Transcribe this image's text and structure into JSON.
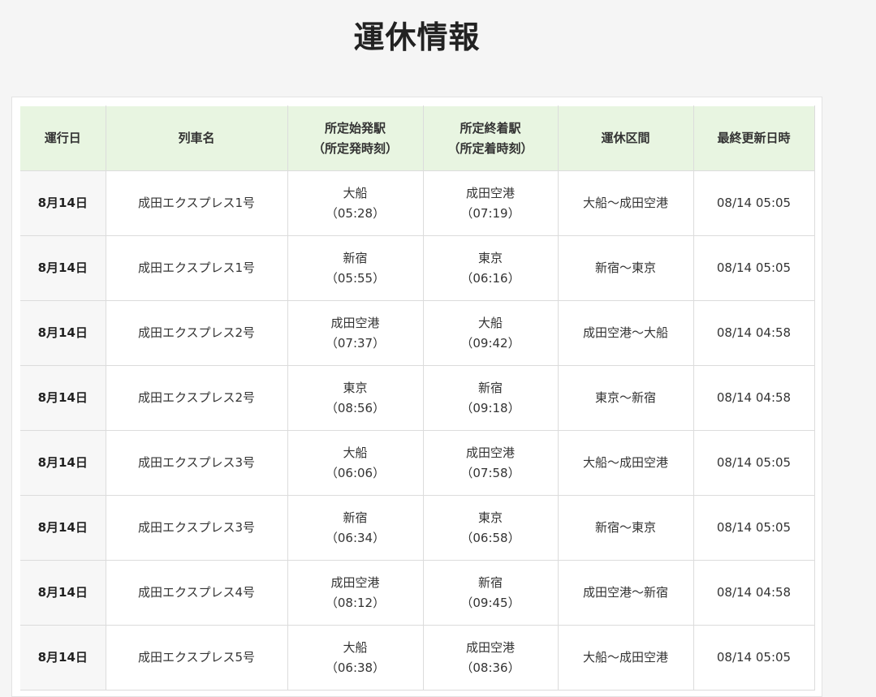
{
  "page": {
    "title": "運休情報"
  },
  "table": {
    "headers": [
      {
        "line1": "運行日",
        "line2": ""
      },
      {
        "line1": "列車名",
        "line2": ""
      },
      {
        "line1": "所定始発駅",
        "line2": "（所定発時刻）"
      },
      {
        "line1": "所定終着駅",
        "line2": "（所定着時刻）"
      },
      {
        "line1": "運休区間",
        "line2": ""
      },
      {
        "line1": "最終更新日時",
        "line2": ""
      }
    ],
    "rows": [
      {
        "date": "8月14日",
        "train": "成田エクスプレス1号",
        "origin": "大船",
        "origin_time": "（05:28）",
        "dest": "成田空港",
        "dest_time": "（07:19）",
        "section": "大船～成田空港",
        "updated": "08/14 05:05"
      },
      {
        "date": "8月14日",
        "train": "成田エクスプレス1号",
        "origin": "新宿",
        "origin_time": "（05:55）",
        "dest": "東京",
        "dest_time": "（06:16）",
        "section": "新宿～東京",
        "updated": "08/14 05:05"
      },
      {
        "date": "8月14日",
        "train": "成田エクスプレス2号",
        "origin": "成田空港",
        "origin_time": "（07:37）",
        "dest": "大船",
        "dest_time": "（09:42）",
        "section": "成田空港～大船",
        "updated": "08/14 04:58"
      },
      {
        "date": "8月14日",
        "train": "成田エクスプレス2号",
        "origin": "東京",
        "origin_time": "（08:56）",
        "dest": "新宿",
        "dest_time": "（09:18）",
        "section": "東京～新宿",
        "updated": "08/14 04:58"
      },
      {
        "date": "8月14日",
        "train": "成田エクスプレス3号",
        "origin": "大船",
        "origin_time": "（06:06）",
        "dest": "成田空港",
        "dest_time": "（07:58）",
        "section": "大船～成田空港",
        "updated": "08/14 05:05"
      },
      {
        "date": "8月14日",
        "train": "成田エクスプレス3号",
        "origin": "新宿",
        "origin_time": "（06:34）",
        "dest": "東京",
        "dest_time": "（06:58）",
        "section": "新宿～東京",
        "updated": "08/14 05:05"
      },
      {
        "date": "8月14日",
        "train": "成田エクスプレス4号",
        "origin": "成田空港",
        "origin_time": "（08:12）",
        "dest": "新宿",
        "dest_time": "（09:45）",
        "section": "成田空港～新宿",
        "updated": "08/14 04:58"
      },
      {
        "date": "8月14日",
        "train": "成田エクスプレス5号",
        "origin": "大船",
        "origin_time": "（06:38）",
        "dest": "成田空港",
        "dest_time": "（08:36）",
        "section": "大船～成田空港",
        "updated": "08/14 05:05"
      }
    ]
  },
  "colors": {
    "header_bg": "#e8f5e1",
    "date_cell_bg": "#f7f7f7",
    "page_bg": "#f5f5f5"
  }
}
